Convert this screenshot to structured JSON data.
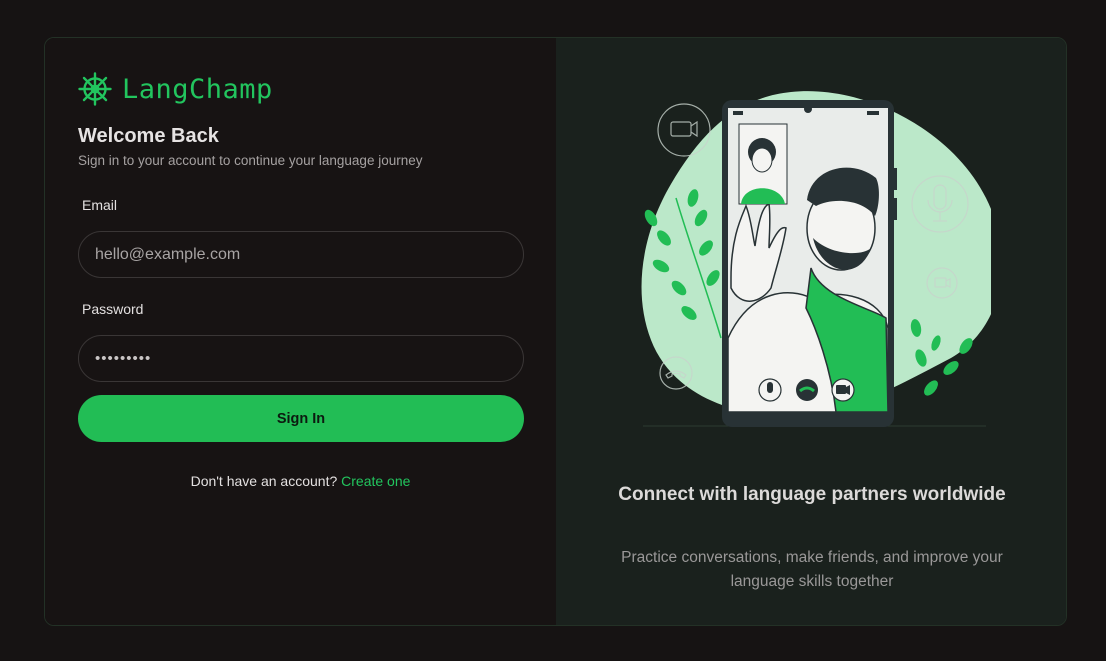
{
  "brand": {
    "name": "LangChamp",
    "icon": "dharma-wheel-icon",
    "color": "#22c55e"
  },
  "login": {
    "heading": "Welcome Back",
    "subheading": "Sign in to your account to continue your language journey",
    "email_label": "Email",
    "email_placeholder": "hello@example.com",
    "password_label": "Password",
    "password_value": "•••••••••",
    "submit_label": "Sign In",
    "signup_prompt": "Don't have an account?",
    "signup_link": "Create one"
  },
  "promo": {
    "headline": "Connect with language partners worldwide",
    "description": "Practice conversations, make friends, and improve your language skills together"
  },
  "colors": {
    "accent": "#22bd55",
    "background": "#161313",
    "panel_right": "#1a211d"
  }
}
